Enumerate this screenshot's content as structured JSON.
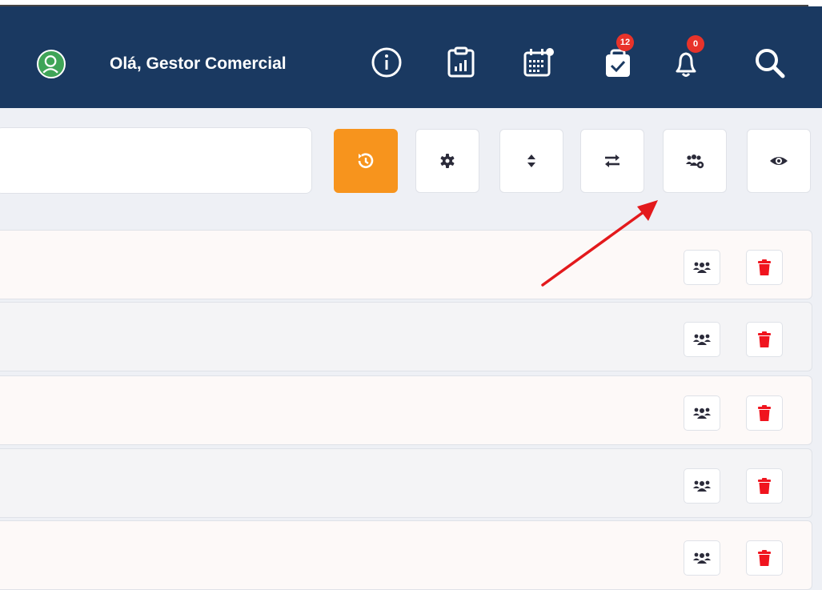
{
  "header": {
    "greeting": "Olá, Gestor Comercial",
    "icons": [
      "user-avatar-icon",
      "info-icon",
      "report-icon",
      "calendar-icon",
      "tasks-icon",
      "bell-icon",
      "search-icon"
    ],
    "tasks_badge": "12",
    "notifications_badge": "0",
    "colors": {
      "background": "#1a3961",
      "avatar": "#3fa457",
      "badge": "#e8332a"
    }
  },
  "toolbar": {
    "search_value": "",
    "buttons": [
      "history-icon",
      "gear-icon",
      "sort-icon",
      "exchange-icon",
      "users-cog-icon",
      "eye-icon"
    ],
    "colors": {
      "history_button": "#f7941d"
    }
  },
  "rows": [
    {
      "actions": [
        "users-icon",
        "trash-icon"
      ]
    },
    {
      "actions": [
        "users-icon",
        "trash-icon"
      ]
    },
    {
      "actions": [
        "users-icon",
        "trash-icon"
      ]
    },
    {
      "actions": [
        "users-icon",
        "trash-icon"
      ]
    },
    {
      "actions": [
        "users-icon",
        "trash-icon"
      ]
    }
  ],
  "annotation": {
    "type": "red-arrow",
    "points_to": "users-cog-icon",
    "color": "#e3191c"
  }
}
